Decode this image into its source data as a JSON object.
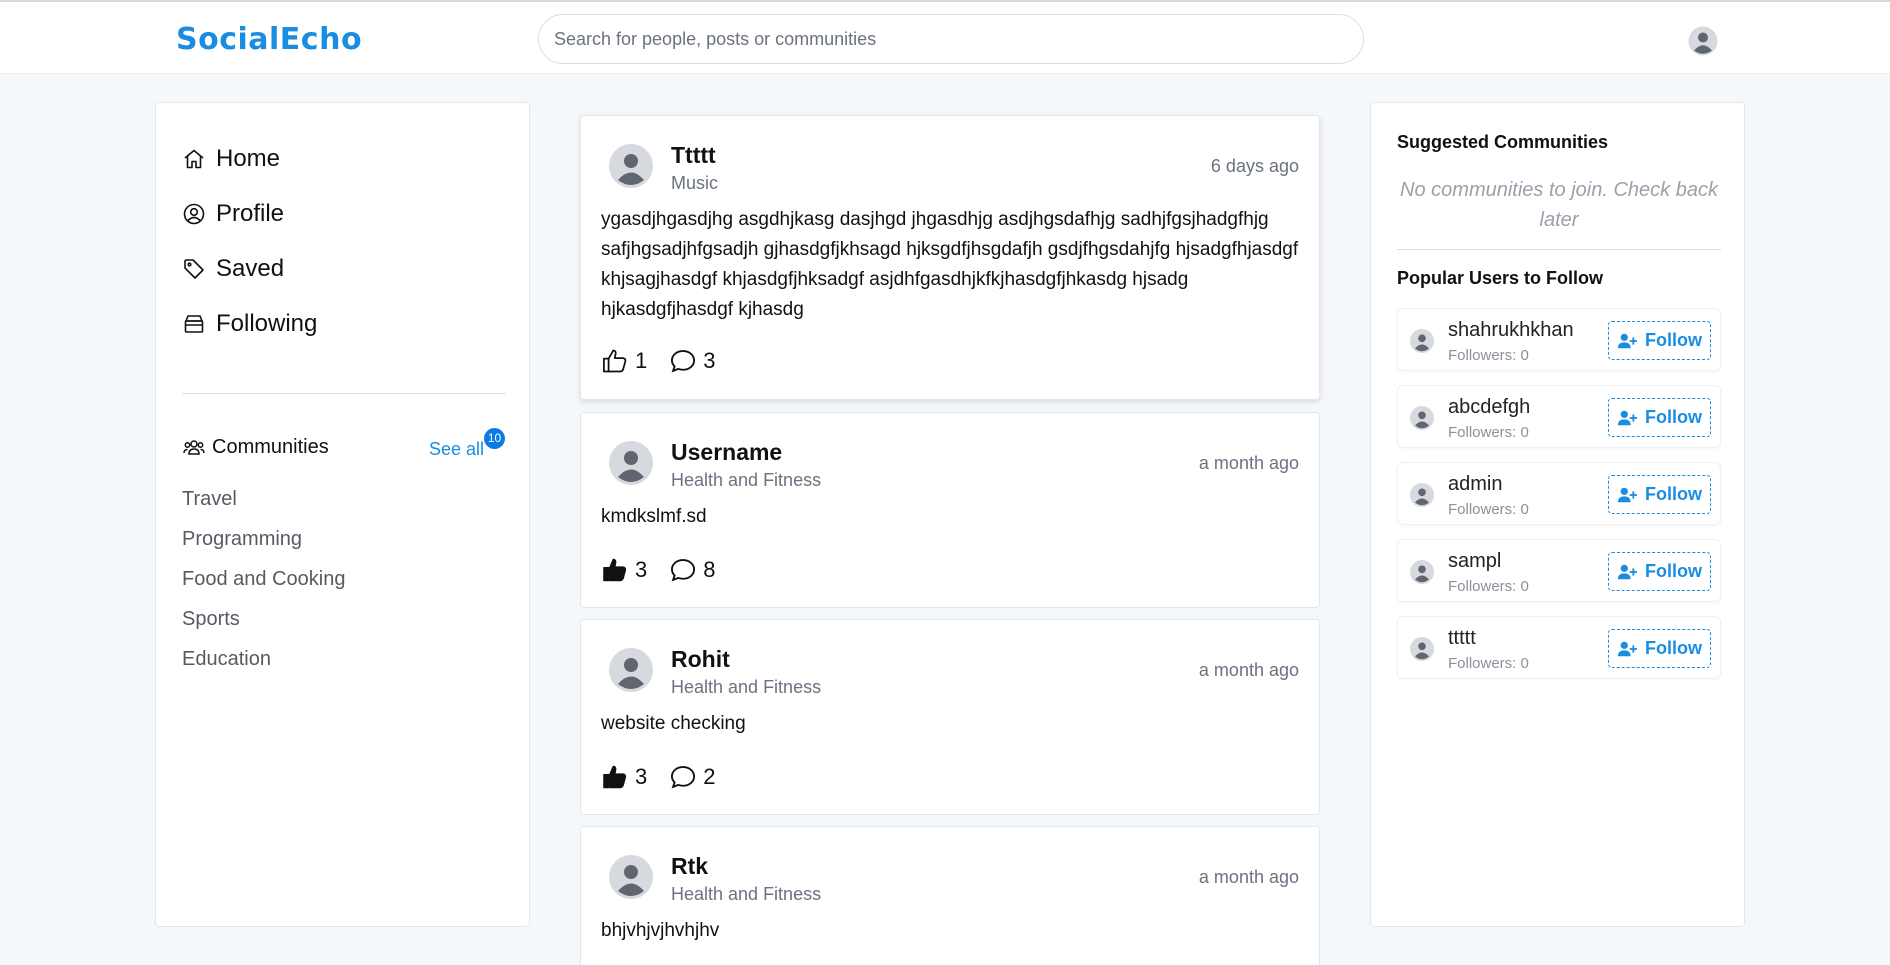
{
  "header": {
    "logo": "SocialEcho",
    "search_placeholder": "Search for people, posts or communities"
  },
  "sidebar": {
    "nav": [
      {
        "label": "Home",
        "icon": "home-icon"
      },
      {
        "label": "Profile",
        "icon": "user-circle-icon"
      },
      {
        "label": "Saved",
        "icon": "tag-icon"
      },
      {
        "label": "Following",
        "icon": "archive-icon"
      }
    ],
    "communities_label": "Communities",
    "see_all_label": "See all",
    "communities_count": "10",
    "communities": [
      "Travel",
      "Programming",
      "Food and Cooking",
      "Sports",
      "Education"
    ]
  },
  "posts": [
    {
      "username": "Ttttt",
      "community": "Music",
      "time": "6 days ago",
      "text": "ygasdjhgasdjhg asgdhjkasg dasjhgd jhgasdhjg asdjhgsdafhjg sadhjfgsjhadgfhjg safjhgsadjhfgsadjh gjhasdgfjkhsagd hjksgdfjhsgdafjh gsdjfhgsdahjfg hjsadgfhjasdgf khjsagjhasdgf khjasdgfjhksadgf asjdhfgasdhjkfkjhasdgfjhkasdg hjsadg hjkasdgfjhasdgf kjhasdg",
      "likes": "1",
      "liked": false,
      "comments": "3"
    },
    {
      "username": "Username",
      "community": "Health and Fitness",
      "time": "a month ago",
      "text": "kmdkslmf.sd",
      "likes": "3",
      "liked": true,
      "comments": "8"
    },
    {
      "username": "Rohit",
      "community": "Health and Fitness",
      "time": "a month ago",
      "text": "website checking",
      "likes": "3",
      "liked": true,
      "comments": "2"
    },
    {
      "username": "Rtk",
      "community": "Health and Fitness",
      "time": "a month ago",
      "text": "bhjvhjvjhvhjhv"
    }
  ],
  "right": {
    "suggested_title": "Suggested Communities",
    "empty_text": "No communities to join. Check back later",
    "popular_title": "Popular Users to Follow",
    "follow_label": "Follow",
    "users": [
      {
        "name": "shahrukhkhan",
        "followers": "Followers: 0"
      },
      {
        "name": "abcdefgh",
        "followers": "Followers: 0"
      },
      {
        "name": "admin",
        "followers": "Followers: 0"
      },
      {
        "name": "sampl",
        "followers": "Followers: 0"
      },
      {
        "name": "ttttt",
        "followers": "Followers: 0"
      }
    ]
  },
  "colors": {
    "accent": "#1a8de0",
    "badge": "#0d7ae6",
    "background": "#f5f8fb",
    "muted_text": "#6b7280"
  }
}
